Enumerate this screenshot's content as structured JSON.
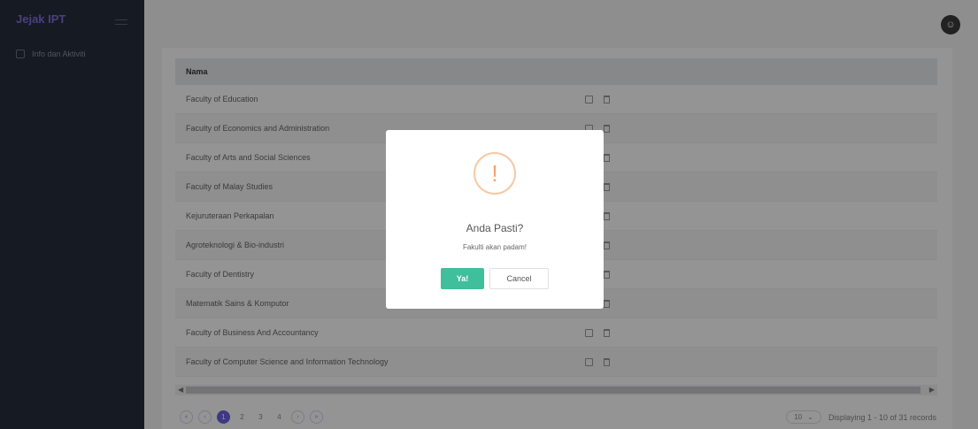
{
  "app": {
    "brand": "Jejak IPT"
  },
  "sidebar": {
    "items": [
      {
        "label": "Info dan Aktiviti",
        "icon": "grid-icon"
      }
    ]
  },
  "header": {
    "avatar_icon": "user-icon"
  },
  "table": {
    "columns": [
      "Nama"
    ],
    "rows": [
      "Faculty of Education",
      "Faculty of Economics and Administration",
      "Faculty of Arts and Social Sciences",
      "Faculty of Malay Studies",
      "Kejuruteraan Perkapalan",
      "Agroteknologi & Bio-industri",
      "Faculty of Dentistry",
      "Matematik Sains & Komputor",
      "Faculty of Business And Accountancy",
      "Faculty of Computer Science and Information Technology"
    ]
  },
  "pagination": {
    "pages": [
      "1",
      "2",
      "3",
      "4"
    ],
    "current": "1",
    "per_page": "10",
    "summary": "Displaying 1 - 10 of 31 records"
  },
  "modal": {
    "icon": "!",
    "title": "Anda Pasti?",
    "text": "Fakulti akan padam!",
    "confirm_label": "Ya!",
    "cancel_label": "Cancel"
  },
  "colors": {
    "accent": "#6c5fe0",
    "confirm": "#3fbf9c",
    "warning": "#f3a26a",
    "sidebar": "#262d3c"
  }
}
